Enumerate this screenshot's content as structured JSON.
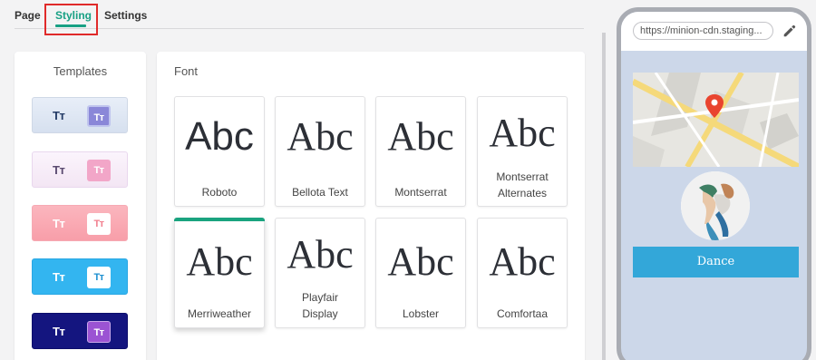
{
  "tabs": {
    "page": "Page",
    "styling": "Styling",
    "settings": "Settings"
  },
  "templates": {
    "title": "Templates",
    "items": [
      {
        "sample": "Tт",
        "chip": "Tт"
      },
      {
        "sample": "Tт",
        "chip": "Tт"
      },
      {
        "sample": "Tт",
        "chip": "Tт"
      },
      {
        "sample": "Tт",
        "chip": "Tт"
      },
      {
        "sample": "Tт",
        "chip": "Tт"
      }
    ]
  },
  "font": {
    "title": "Font",
    "sample": "Abc",
    "options": [
      {
        "name": "Roboto"
      },
      {
        "name": "Bellota Text"
      },
      {
        "name": "Montserrat"
      },
      {
        "name": "Montserrat Alternates"
      },
      {
        "name": "Merriweather",
        "selected": true
      },
      {
        "name": "Playfair Display"
      },
      {
        "name": "Lobster"
      },
      {
        "name": "Comfortaa"
      }
    ]
  },
  "preview": {
    "url": "https://minion-cdn.staging...",
    "button_label": "Dance"
  },
  "colors": {
    "accent": "#18a084",
    "highlight_box": "#e02a2a",
    "cta": "#33a7d9",
    "phone_bg": "#ccd7e9"
  }
}
